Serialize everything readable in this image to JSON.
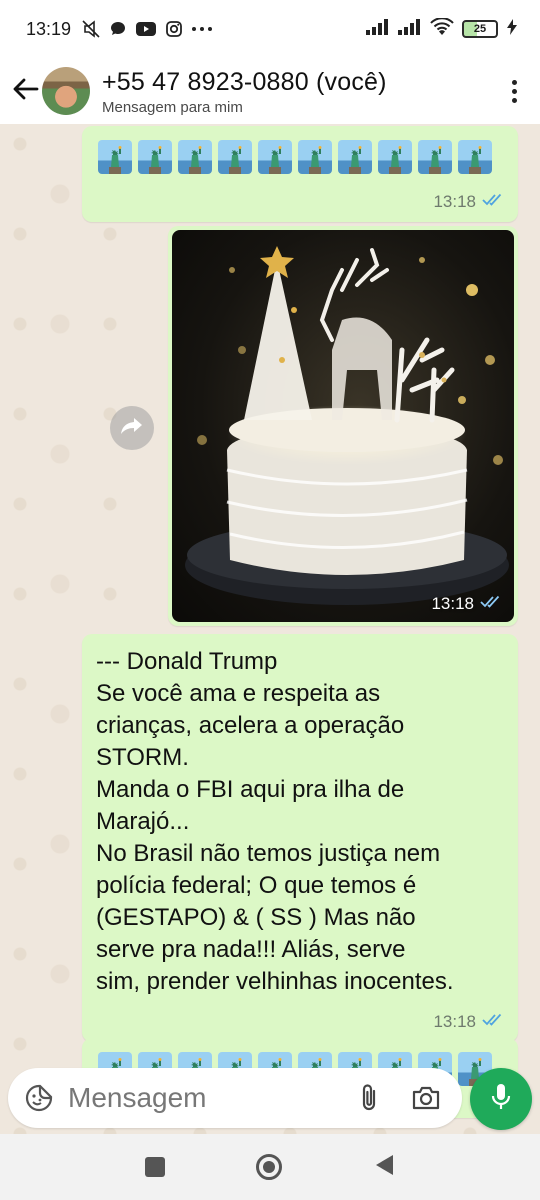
{
  "status_bar": {
    "time": "13:19",
    "battery": "25",
    "icons": [
      "mute-icon",
      "chat-bubble-icon",
      "youtube-icon",
      "instagram-icon",
      "more-dots-icon",
      "signal-icon",
      "signal-icon",
      "wifi-icon",
      "battery-icon",
      "charging-icon"
    ]
  },
  "header": {
    "title": "+55 47 8923-0880 (você)",
    "subtitle": "Mensagem para mim"
  },
  "messages": [
    {
      "type": "emoji",
      "emoji_name": "statue-of-liberty",
      "count": 10,
      "time": "13:18",
      "status": "read-double-check"
    },
    {
      "type": "image",
      "image_description_name": "christmas-cake-photo",
      "time": "13:18",
      "status": "read-double-check"
    },
    {
      "type": "text",
      "lines": [
        "--- Donald Trump",
        "Se você ama e respeita as",
        "crianças, acelera a operação",
        "STORM.",
        "Manda o FBI aqui pra ilha de",
        "Marajó...",
        "No Brasil não temos justiça nem",
        "polícia federal;  O que temos é",
        "(GESTAPO) & ( SS ) Mas não",
        "serve pra nada!!!  Aliás, serve",
        "sim, prender velhinhas inocentes."
      ],
      "time": "13:18",
      "status": "read-double-check"
    }
  ],
  "input": {
    "placeholder": "Mensagem"
  },
  "colors": {
    "outgoing_bubble": "#dcf8c6",
    "mic_button": "#1faa5a",
    "read_check": "#4fa3e0",
    "chat_background": "#efe7dd"
  }
}
